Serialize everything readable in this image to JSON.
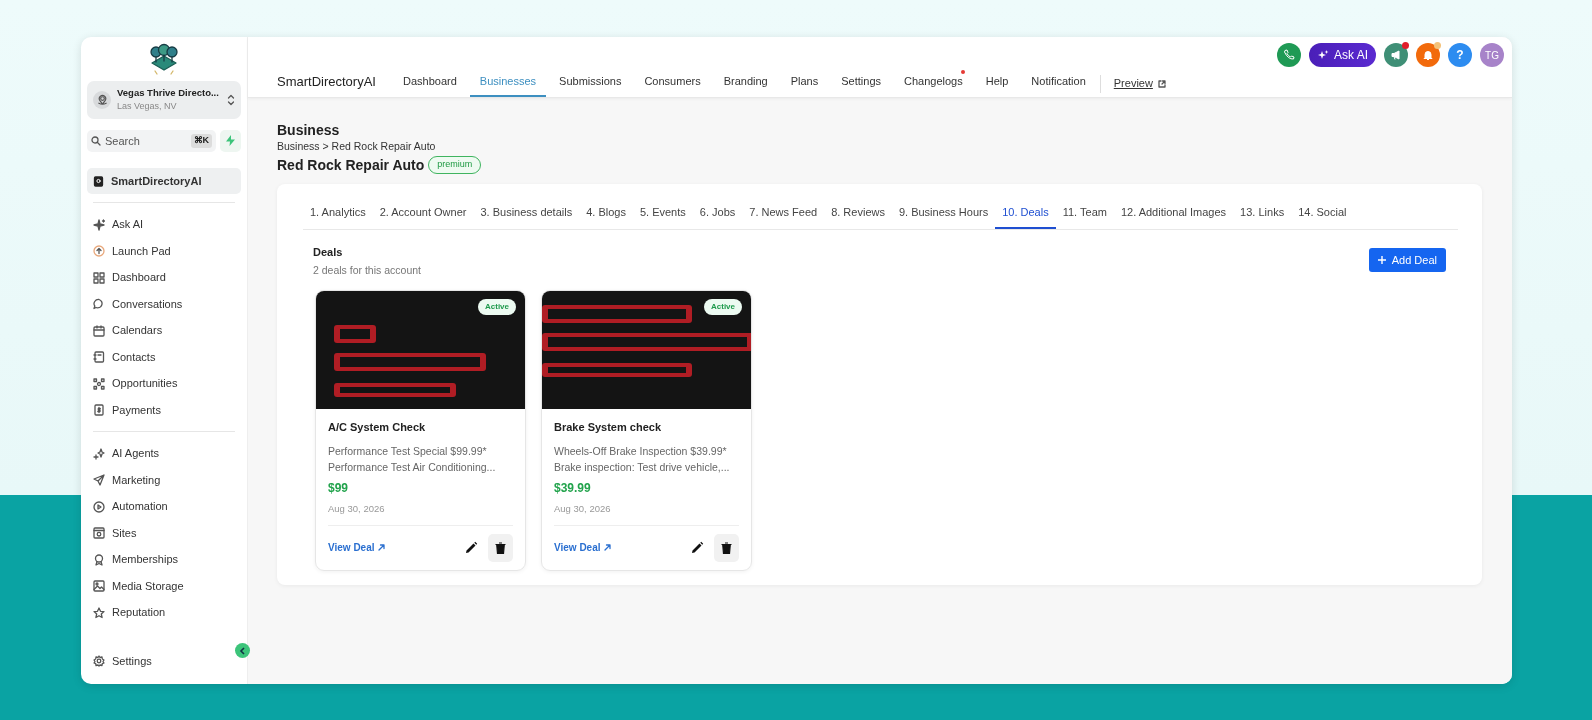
{
  "sidebar": {
    "account": {
      "name": "Vegas Thrive Directo...",
      "location": "Las Vegas, NV"
    },
    "search": {
      "placeholder": "Search",
      "shortcut": "⌘K"
    },
    "pinned": {
      "label": "SmartDirectoryAI",
      "selected": true
    },
    "groups": [
      [
        {
          "label": "Ask AI",
          "selected": false
        },
        {
          "label": "Launch Pad",
          "selected": false
        },
        {
          "label": "Dashboard",
          "selected": false
        },
        {
          "label": "Conversations",
          "selected": false
        },
        {
          "label": "Calendars",
          "selected": false
        },
        {
          "label": "Contacts",
          "selected": false
        },
        {
          "label": "Opportunities",
          "selected": false
        },
        {
          "label": "Payments",
          "selected": false
        }
      ],
      [
        {
          "label": "AI Agents",
          "selected": false
        },
        {
          "label": "Marketing",
          "selected": false
        },
        {
          "label": "Automation",
          "selected": false
        },
        {
          "label": "Sites",
          "selected": false
        },
        {
          "label": "Memberships",
          "selected": false
        },
        {
          "label": "Media Storage",
          "selected": false
        },
        {
          "label": "Reputation",
          "selected": false
        }
      ]
    ],
    "footer": {
      "label": "Settings"
    }
  },
  "topbar": {
    "ask_ai": "Ask AI",
    "megaphone_dot": true,
    "bell_dot": true,
    "help": "?",
    "avatar": "TG"
  },
  "nav": {
    "brand": "SmartDirectoryAI",
    "items": [
      {
        "label": "Dashboard",
        "selected": false,
        "dot": false
      },
      {
        "label": "Businesses",
        "selected": true,
        "dot": false
      },
      {
        "label": "Submissions",
        "selected": false,
        "dot": false
      },
      {
        "label": "Consumers",
        "selected": false,
        "dot": false
      },
      {
        "label": "Branding",
        "selected": false,
        "dot": false
      },
      {
        "label": "Plans",
        "selected": false,
        "dot": false
      },
      {
        "label": "Settings",
        "selected": false,
        "dot": false
      },
      {
        "label": "Changelogs",
        "selected": false,
        "dot": true
      },
      {
        "label": "Help",
        "selected": false,
        "dot": false
      },
      {
        "label": "Notification",
        "selected": false,
        "dot": false
      }
    ],
    "preview": "Preview"
  },
  "header": {
    "title": "Business",
    "breadcrumb": "Business > Red Rock Repair Auto",
    "name": "Red Rock Repair Auto",
    "badge": "premium"
  },
  "tabs": [
    {
      "label": "1. Analytics",
      "selected": false
    },
    {
      "label": "2. Account Owner",
      "selected": false
    },
    {
      "label": "3. Business details",
      "selected": false
    },
    {
      "label": "4. Blogs",
      "selected": false
    },
    {
      "label": "5. Events",
      "selected": false
    },
    {
      "label": "6. Jobs",
      "selected": false
    },
    {
      "label": "7. News Feed",
      "selected": false
    },
    {
      "label": "8. Reviews",
      "selected": false
    },
    {
      "label": "9. Business Hours",
      "selected": false
    },
    {
      "label": "10. Deals",
      "selected": true
    },
    {
      "label": "11. Team",
      "selected": false
    },
    {
      "label": "12. Additional Images",
      "selected": false
    },
    {
      "label": "13. Links",
      "selected": false
    },
    {
      "label": "14. Social",
      "selected": false
    }
  ],
  "deals": {
    "title": "Deals",
    "subtitle": "2 deals for this account",
    "add_button": "Add Deal",
    "items": [
      {
        "status": "Active",
        "title": "A/C System Check",
        "description": "Performance Test Special $99.99* Performance Test Air Conditioning...",
        "price": "$99",
        "date": "Aug 30, 2026",
        "link": "View Deal"
      },
      {
        "status": "Active",
        "title": "Brake System check",
        "description": "Wheels-Off Brake Inspection $39.99* Brake inspection: Test drive vehicle,...",
        "price": "$39.99",
        "date": "Aug 30, 2026",
        "link": "View Deal"
      }
    ]
  }
}
